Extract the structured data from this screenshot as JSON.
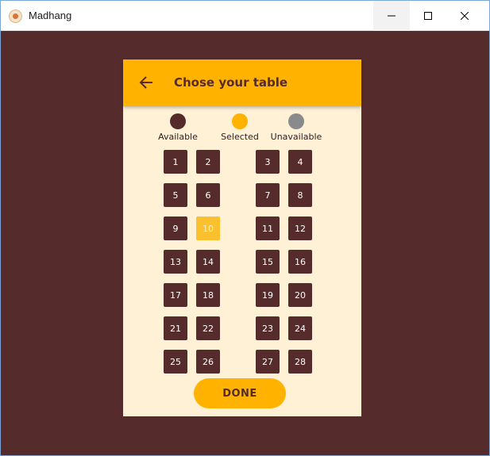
{
  "window": {
    "title": "Madhang",
    "icon": "app-logo-icon"
  },
  "appbar": {
    "title": "Chose your table",
    "back_icon": "arrow-back-icon"
  },
  "legend": [
    {
      "label": "Available",
      "color": "#552b2b"
    },
    {
      "label": "Selected",
      "color": "#ffb300"
    },
    {
      "label": "Unavailable",
      "color": "#8a8a8a"
    }
  ],
  "tables": {
    "items": [
      "1",
      "2",
      "3",
      "4",
      "5",
      "6",
      "7",
      "8",
      "9",
      "10",
      "11",
      "12",
      "13",
      "14",
      "15",
      "16",
      "17",
      "18",
      "19",
      "20",
      "21",
      "22",
      "23",
      "24",
      "25",
      "26",
      "27",
      "28"
    ],
    "selected": "10"
  },
  "colors": {
    "background": "#552b2b",
    "accent": "#ffb300",
    "card": "#fff1d6",
    "selected_seat": "#fbc02d"
  },
  "done_label": "DONE"
}
